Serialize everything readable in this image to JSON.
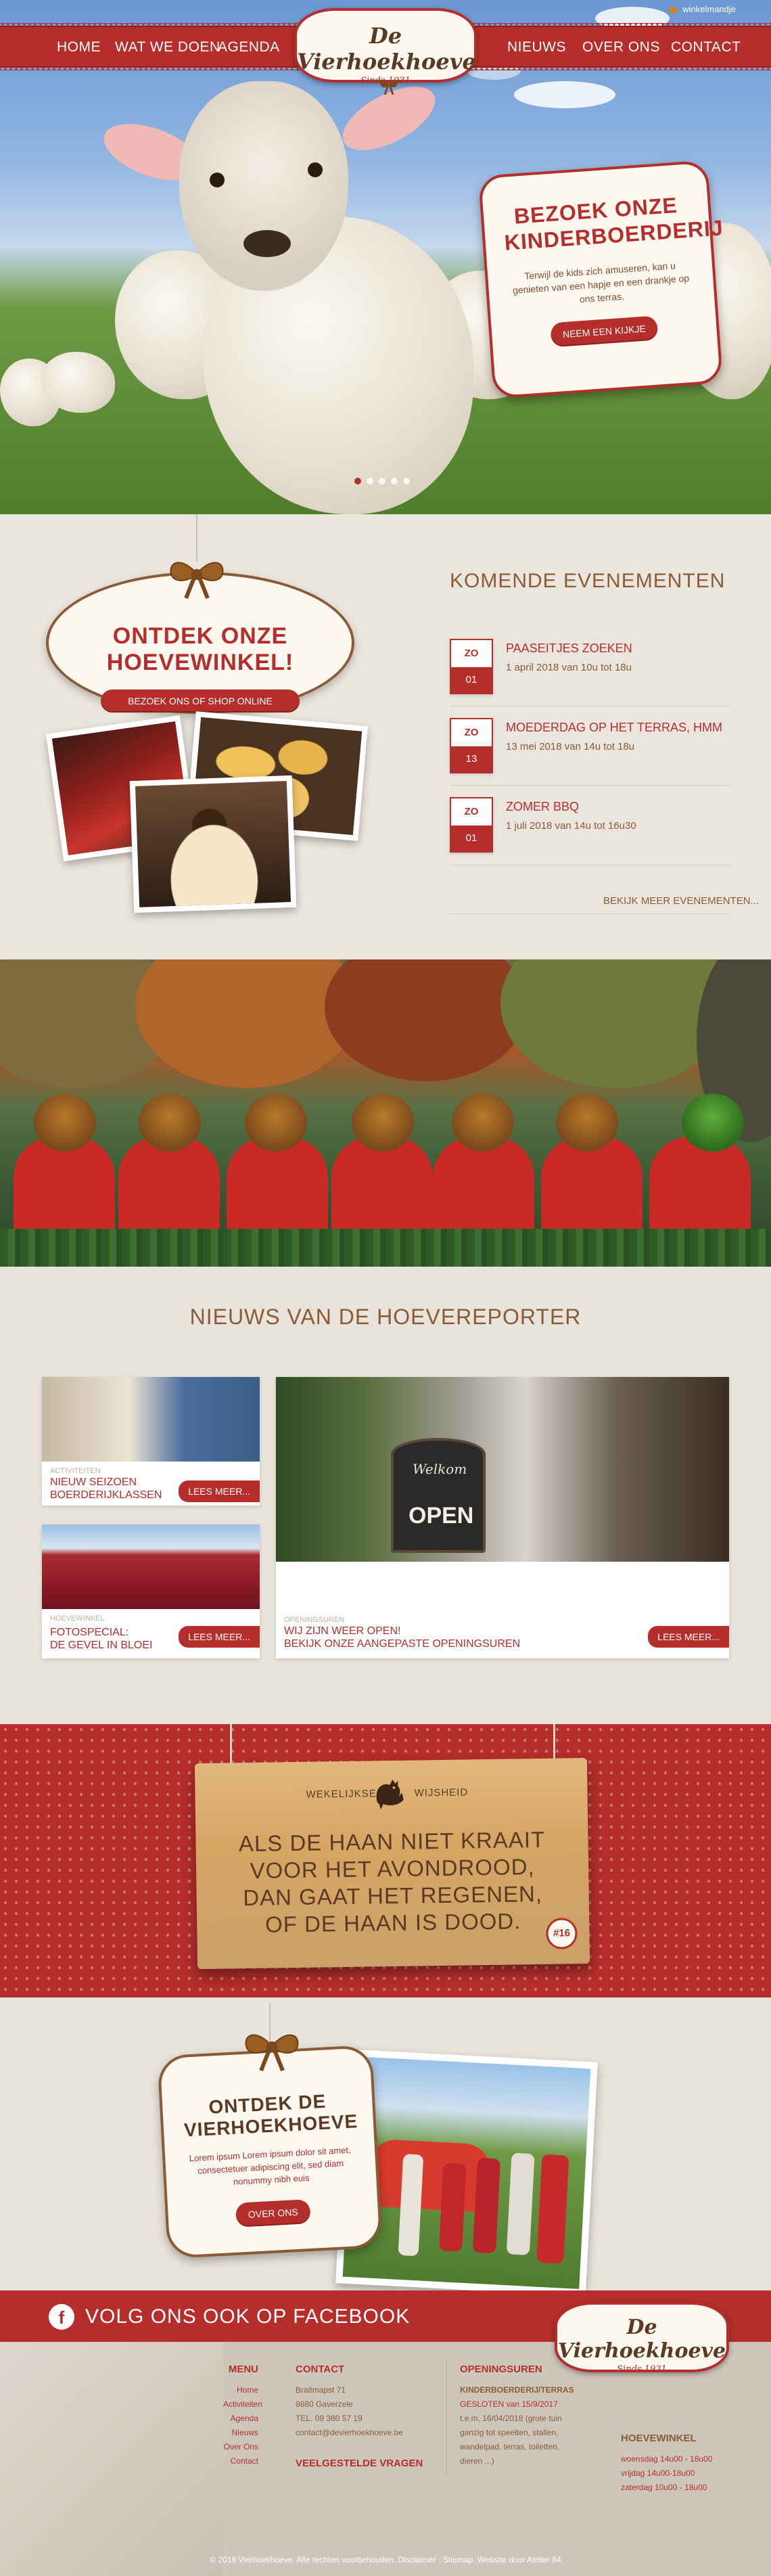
{
  "header": {
    "cart_label": "winkelmandje",
    "nav_left": [
      "HOME",
      "WAT WE DOEN",
      "AGENDA"
    ],
    "nav_right": [
      "NIEUWS",
      "OVER ONS",
      "CONTACT"
    ],
    "logo_title": "De Vierhoekhoeve",
    "logo_since": "Sinds 1931"
  },
  "hero": {
    "card_title_line1": "BEZOEK ONZE",
    "card_title_line2": "KINDERBOERDERIJ",
    "card_text": "Terwijl de kids zich amuseren, kan u genieten van een hapje en een drankje op ons terras.",
    "card_button": "NEEM EEN KIJKJE",
    "slides": 5,
    "active_slide": 1
  },
  "shop": {
    "title": "ONTDEK ONZE HOEVEWINKEL!",
    "button": "BEZOEK ONS OF SHOP ONLINE"
  },
  "events": {
    "title": "KOMENDE EVENEMENTEN",
    "items": [
      {
        "day": "ZO",
        "date": "01",
        "title": "PAASEITJES ZOEKEN",
        "subtitle": "1 april 2018 van 10u tot 18u"
      },
      {
        "day": "ZO",
        "date": "13",
        "title": "MOEDERDAG OP HET TERRAS, HMM",
        "subtitle": "13 mei 2018 van 14u tot 18u"
      },
      {
        "day": "ZO",
        "date": "01",
        "title": "ZOMER BBQ",
        "subtitle": "1 juli 2018 van 14u tot 16u30"
      }
    ],
    "more_link": "BEKIJK MEER EVENEMENTEN..."
  },
  "news": {
    "title": "NIEUWS VAN DE HOEVEREPORTER",
    "items": [
      {
        "category": "ACTIVITEITEN",
        "title_line1": "NIEUW SEIZOEN",
        "title_line2": "BOERDERIJKLASSEN",
        "more": "LEES MEER..."
      },
      {
        "category": "HOEVEWINKEL",
        "title_line1": "FOTOSPECIAL:",
        "title_line2": "DE GEVEL IN BLOEI",
        "more": "LEES MEER..."
      },
      {
        "category": "OPENINGSUREN",
        "title_line1": "WIJ ZIJN WEER OPEN!",
        "title_line2": "BEKIJK ONZE AANGEPASTE OPENINGSUREN",
        "more": "LEES MEER..."
      }
    ],
    "sign_text_top": "Welkom",
    "sign_text_bottom": "OPEN"
  },
  "wisdom": {
    "label_left": "WEKELIJKSE",
    "label_right": "WIJSHEID",
    "quote_line1": "ALS DE HAAN NIET KRAAIT",
    "quote_line2": "VOOR HET AVONDROOD,",
    "quote_line3": "DAN GAAT HET REGENEN,",
    "quote_line4": "OF DE HAAN IS DOOD.",
    "number": "#16"
  },
  "about": {
    "title_line1": "ONTDEK DE",
    "title_line2": "VIERHOEKHOEVE",
    "text": "Lorem ipsum Lorem ipsum dolor sit amet, consectetuer adipiscing elit, sed diam nonummy nibh euis",
    "button": "OVER ONS"
  },
  "facebook": {
    "icon_letter": "f",
    "text": "VOLG ONS OOK OP FACEBOOK"
  },
  "footer": {
    "menu_title": "MENU",
    "menu_items": [
      "Home",
      "Activiteiten",
      "Agenda",
      "Nieuws",
      "Over Ons",
      "Contact"
    ],
    "contact_title": "CONTACT",
    "contact_lines": [
      "Braitmapst 71",
      "9880 Gaverzele",
      "TEL. 09 380 57 19",
      "contact@devierhoekhoeve.be"
    ],
    "faq_title": "VEELGESTELDE VRAGEN",
    "hours_title": "OPENINGSUREN",
    "hours_sub": "KINDERBOERDERIJ/TERRAS",
    "hours_closed": "GESLOTEN van 15/9/2017",
    "hours_lines": [
      "t.e.m. 16/04/2018 (grote tuin",
      "ganzig tot speelten, stallen,",
      "wandelpad, terras, toiletten,",
      "dieren ...)"
    ],
    "shop_title": "HOEVEWINKEL",
    "shop_lines": [
      "woensdag 14u00 - 18u00",
      "vrijdag 14u00-18u00",
      "zaterdag 10u00 - 18u00"
    ],
    "copyright": "© 2018 Vierhoekhoeve. Alle rechten voorbehouden. Disclaimer · Sitemap. Website door Atelier 84"
  }
}
